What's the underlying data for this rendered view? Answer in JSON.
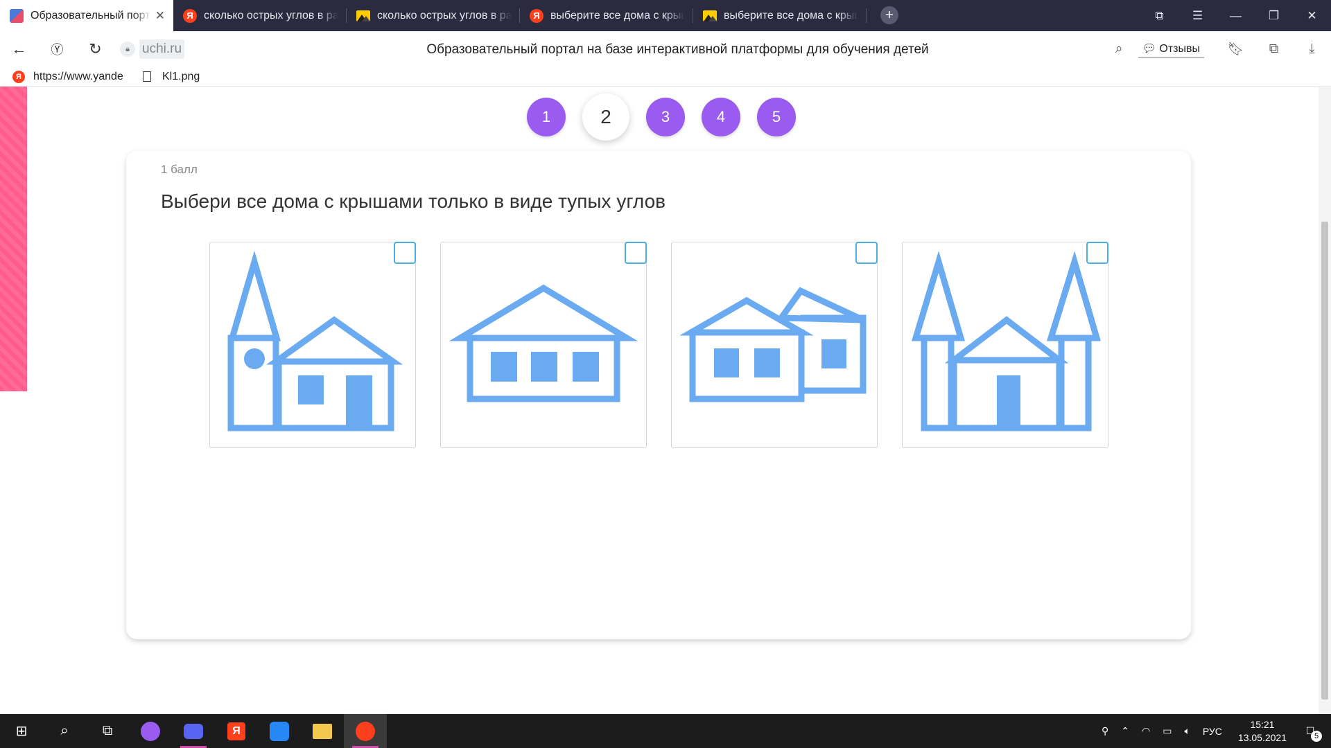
{
  "browser": {
    "tabs": [
      {
        "title": "Образовательный портал на базе интерактивной платформы",
        "icon": "uchi-favicon",
        "active": true
      },
      {
        "title": "сколько острых углов в ра",
        "icon": "yandex-favicon",
        "active": false
      },
      {
        "title": "сколько острых углов в ра",
        "icon": "images-favicon",
        "active": false
      },
      {
        "title": "выберите все дома с крыш",
        "icon": "yandex-favicon",
        "active": false
      },
      {
        "title": "выберите все дома с крыш",
        "icon": "images-favicon",
        "active": false
      }
    ],
    "close_glyph": "✕",
    "new_tab_glyph": "+",
    "domain": "uchi.ru",
    "page_title": "Образовательный портал на базе интерактивной платформы для обучения детей",
    "reviews_label": "Отзывы",
    "bookmarks": [
      {
        "label": "https://www.yande",
        "icon": "yandex-favicon"
      },
      {
        "label": "Kl1.png",
        "icon": "file-icon"
      }
    ]
  },
  "quiz": {
    "steps": [
      "1",
      "2",
      "3",
      "4",
      "5"
    ],
    "current_step": 2,
    "points": "1 балл",
    "question": "Выбери все дома с крышами только в виде тупых углов",
    "options": [
      {
        "picture": "house-with-tower-and-circle-window",
        "checked": false
      },
      {
        "picture": "house-with-three-windows",
        "checked": false
      },
      {
        "picture": "two-joined-houses",
        "checked": false
      },
      {
        "picture": "house-with-two-towers",
        "checked": false
      }
    ],
    "drawing_color": "#6aaaf0",
    "checkbox_color": "#4ab0e0",
    "step_color": "#9a5cf0"
  },
  "taskbar": {
    "language": "РУС",
    "time": "15:21",
    "date": "13.05.2021",
    "notification_count": "5"
  }
}
